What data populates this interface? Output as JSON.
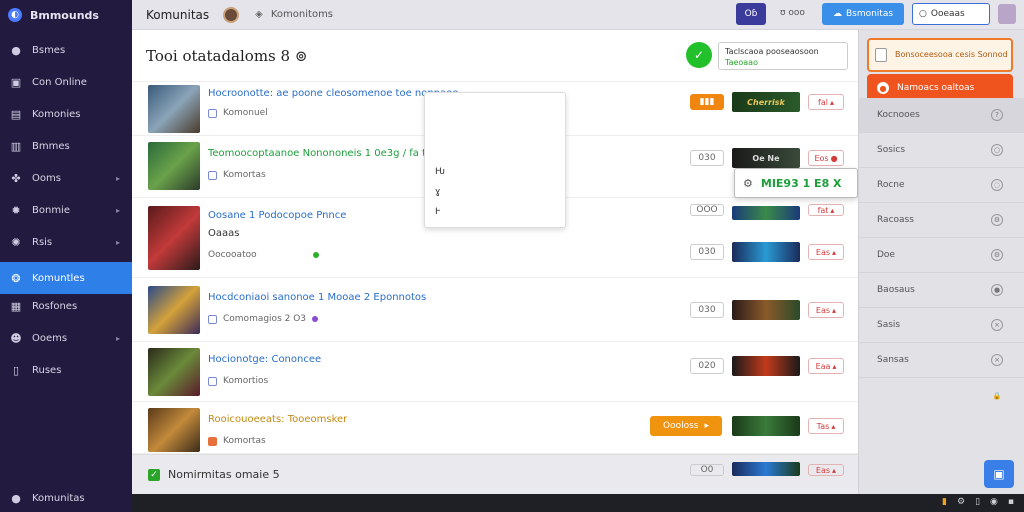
{
  "sidebar": {
    "brand": "Bmmounds",
    "items": [
      {
        "label": "Bsmes",
        "icon": "circle-icon",
        "glyph": "●"
      },
      {
        "label": "Con Online",
        "icon": "bag-icon",
        "glyph": "▣"
      },
      {
        "label": "Komonies",
        "icon": "box-icon",
        "glyph": "▤"
      },
      {
        "label": "Bmmes",
        "icon": "book-icon",
        "glyph": "▥"
      },
      {
        "label": "Ooms",
        "icon": "puzzle-icon",
        "glyph": "✤"
      },
      {
        "label": "Bonmie",
        "icon": "star-icon",
        "glyph": "✹"
      },
      {
        "label": "Rsis",
        "icon": "gear-icon",
        "glyph": "✺"
      },
      {
        "label": "Komuntles",
        "icon": "community-icon",
        "glyph": "❂"
      },
      {
        "label": "Rosfones",
        "icon": "chat-icon",
        "glyph": "▦"
      },
      {
        "label": "Ooems",
        "icon": "smile-icon",
        "glyph": "☻"
      },
      {
        "label": "Ruses",
        "icon": "grid-icon",
        "glyph": "▯"
      }
    ],
    "footer": {
      "label": "Komunitas",
      "icon": "user-icon",
      "glyph": "●"
    }
  },
  "topbar": {
    "title": "Komunitas",
    "crumb": "Komonitoms",
    "dark_btn": "Oɓ",
    "small_text": "ʊ ooo",
    "blue_btn": "Bsmonitas",
    "search_value": "Ooeaas"
  },
  "main": {
    "title": "Tooi otatadaloms 8 ⊚",
    "notice_line1": "Taclscaoa pooseaosoon",
    "notice_line2": "Taeoaao",
    "rows": [
      {
        "title": "Hocroonotte: ae poone cleosomenoe toe nonnaee",
        "sub": "Komonuel",
        "count": "▮▮▮",
        "banner": "Cherrisk",
        "tag": "fal"
      },
      {
        "title": "Teomoocoptaanoe Nonononeis 1 0e3g / fa ta",
        "sub": "Komortas",
        "count": "030",
        "banner": "Oe Ne",
        "tag": "Eos"
      },
      {
        "title": "Oosane 1 Podocopoe Pnnce",
        "title2": "Oaaas",
        "sub": "Oocooatoo",
        "count": "OOO",
        "banner": "",
        "tag": "fat"
      },
      {
        "title": "Hocdconiaoi sanonoe 1 Mooae 2 Eponnotos",
        "sub": "Comomagios 2 O3",
        "count": "030",
        "banner": "",
        "tag": "Eas"
      },
      {
        "title": "Hocionotge: Cononcee",
        "sub": "Komortios",
        "count": "020",
        "banner": "",
        "tag": "Eaa"
      },
      {
        "title": "Rooicouoeeats: Tooeomsker",
        "sub": "Komortas",
        "count": "020",
        "banner": "",
        "tag": "Tas"
      }
    ],
    "orange_btn": "Oooloss",
    "footer_label": "Nomirmitas omaie 5",
    "extra_count": "O0",
    "extra_tag": "Eas"
  },
  "dropdown": {
    "items": [
      "Ƕ",
      "ɣ",
      "Ⱶ"
    ]
  },
  "tooltip": {
    "text": "MIE93 1 E8 X"
  },
  "rpanel": {
    "alert_text": "Bonsoceesooa cesis Sonnod",
    "alert_btn": "Namoacs oaltoas",
    "items": [
      "Kocnooes",
      "Sosics",
      "Rocne",
      "Racoass",
      "Doe",
      "Baosaus",
      "Sasis",
      "Sansas",
      ""
    ]
  }
}
